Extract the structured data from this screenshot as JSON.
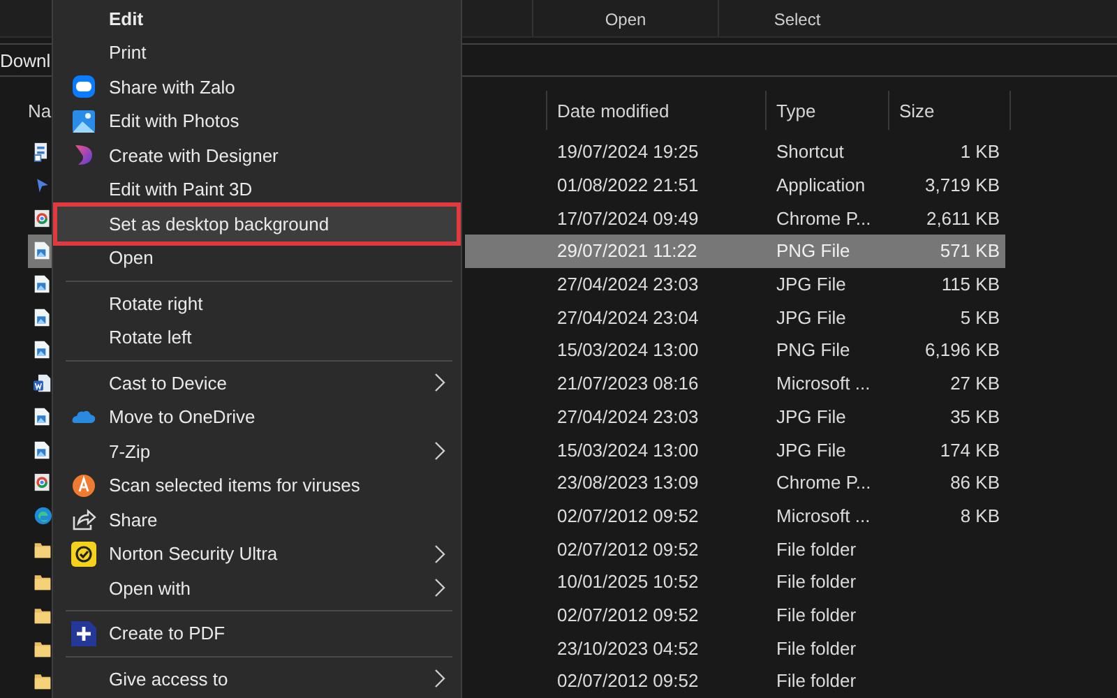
{
  "ribbon": {
    "groups": [
      "Open",
      "Select"
    ]
  },
  "address_bar": {
    "path": "Downl"
  },
  "file_list": {
    "columns": [
      "Na",
      "Date modified",
      "Type",
      "Size"
    ],
    "rows": [
      {
        "kind": "shortcut",
        "date": "19/07/2024 19:25",
        "type": "Shortcut",
        "size": "1 KB",
        "selected": false
      },
      {
        "kind": "app",
        "date": "01/08/2022 21:51",
        "type": "Application",
        "size": "3,719 KB",
        "selected": false
      },
      {
        "kind": "chrome",
        "date": "17/07/2024 09:49",
        "type": "Chrome P...",
        "size": "2,611 KB",
        "selected": false
      },
      {
        "kind": "image",
        "date": "29/07/2021 11:22",
        "type": "PNG File",
        "size": "571 KB",
        "selected": true
      },
      {
        "kind": "image",
        "date": "27/04/2024 23:03",
        "type": "JPG File",
        "size": "115 KB",
        "selected": false
      },
      {
        "kind": "image",
        "date": "27/04/2024 23:04",
        "type": "JPG File",
        "size": "5 KB",
        "selected": false
      },
      {
        "kind": "image",
        "date": "15/03/2024 13:00",
        "type": "PNG File",
        "size": "6,196 KB",
        "selected": false
      },
      {
        "kind": "word",
        "date": "21/07/2023 08:16",
        "type": "Microsoft ...",
        "size": "27 KB",
        "selected": false
      },
      {
        "kind": "image",
        "date": "27/04/2024 23:03",
        "type": "JPG File",
        "size": "35 KB",
        "selected": false
      },
      {
        "kind": "image",
        "date": "15/03/2024 13:00",
        "type": "JPG File",
        "size": "174 KB",
        "selected": false
      },
      {
        "kind": "chrome",
        "date": "23/08/2023 13:09",
        "type": "Chrome P...",
        "size": "86 KB",
        "selected": false
      },
      {
        "kind": "edge",
        "date": "02/07/2012 09:52",
        "type": "Microsoft ...",
        "size": "8 KB",
        "selected": false
      },
      {
        "kind": "folder",
        "date": "02/07/2012 09:52",
        "type": "File folder",
        "selected": false
      },
      {
        "kind": "folder",
        "date": "10/01/2025 10:52",
        "type": "File folder",
        "selected": false
      },
      {
        "kind": "folder",
        "date": "02/07/2012 09:52",
        "type": "File folder",
        "selected": false
      },
      {
        "kind": "folder",
        "date": "23/10/2023 04:52",
        "type": "File folder",
        "selected": false
      },
      {
        "kind": "folder",
        "date": "02/07/2012 09:52",
        "type": "File folder",
        "selected": false
      }
    ]
  },
  "context_menu": {
    "items": [
      {
        "kind": "item",
        "label": "Edit",
        "default": true,
        "submenu": false,
        "selected": false,
        "outlined": false
      },
      {
        "kind": "item",
        "label": "Print",
        "default": false,
        "submenu": false,
        "selected": false,
        "outlined": false
      },
      {
        "kind": "item",
        "label": "Share with Zalo",
        "default": false,
        "submenu": false,
        "selected": false,
        "outlined": false
      },
      {
        "kind": "item",
        "label": "Edit with Photos",
        "default": false,
        "submenu": false,
        "selected": false,
        "outlined": false
      },
      {
        "kind": "item",
        "label": "Create with Designer",
        "default": false,
        "submenu": false,
        "selected": false,
        "outlined": false
      },
      {
        "kind": "item",
        "label": "Edit with Paint 3D",
        "default": false,
        "submenu": false,
        "selected": false,
        "outlined": false
      },
      {
        "kind": "item",
        "label": "Set as desktop background",
        "default": false,
        "submenu": false,
        "selected": true,
        "outlined": true
      },
      {
        "kind": "item",
        "label": "Open",
        "default": false,
        "submenu": false,
        "selected": false,
        "outlined": false
      },
      {
        "kind": "separator"
      },
      {
        "kind": "item",
        "label": "Rotate right",
        "default": false,
        "submenu": false,
        "selected": false,
        "outlined": false
      },
      {
        "kind": "item",
        "label": "Rotate left",
        "default": false,
        "submenu": false,
        "selected": false,
        "outlined": false
      },
      {
        "kind": "separator"
      },
      {
        "kind": "item",
        "label": "Cast to Device",
        "default": false,
        "submenu": true,
        "selected": false,
        "outlined": false
      },
      {
        "kind": "item",
        "label": "Move to OneDrive",
        "default": false,
        "submenu": false,
        "selected": false,
        "outlined": false
      },
      {
        "kind": "item",
        "label": "7-Zip",
        "default": false,
        "submenu": true,
        "selected": false,
        "outlined": false
      },
      {
        "kind": "item",
        "label": "Scan selected items for viruses",
        "default": false,
        "submenu": false,
        "selected": false,
        "outlined": false
      },
      {
        "kind": "item",
        "label": "Share",
        "default": false,
        "submenu": false,
        "selected": false,
        "outlined": false
      },
      {
        "kind": "item",
        "label": "Norton Security Ultra",
        "default": false,
        "submenu": true,
        "selected": false,
        "outlined": false
      },
      {
        "kind": "item",
        "label": "Open with",
        "default": false,
        "submenu": true,
        "selected": false,
        "outlined": false
      },
      {
        "kind": "separator"
      },
      {
        "kind": "item",
        "label": "Create to PDF",
        "default": false,
        "submenu": false,
        "selected": false,
        "outlined": false
      },
      {
        "kind": "separator"
      },
      {
        "kind": "item",
        "label": "Give access to",
        "default": false,
        "submenu": true,
        "selected": false,
        "outlined": false
      }
    ]
  }
}
